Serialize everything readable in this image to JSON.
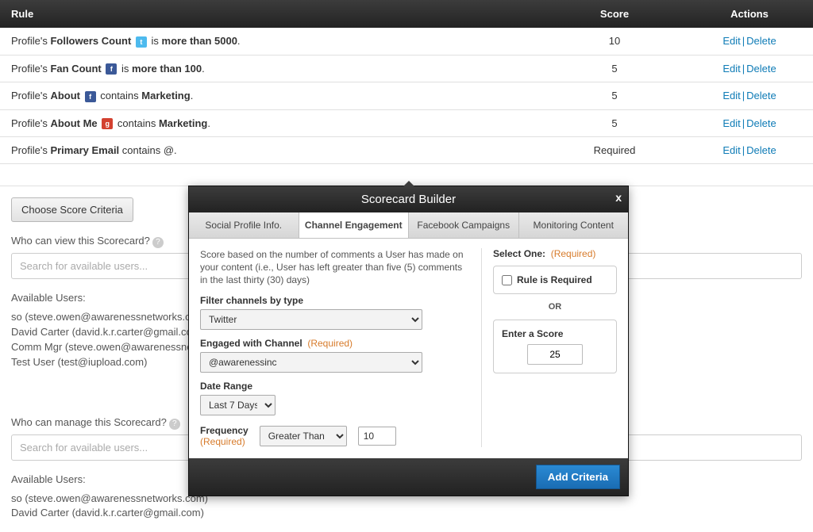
{
  "table": {
    "headers": {
      "rule": "Rule",
      "score": "Score",
      "actions": "Actions"
    },
    "actions": {
      "edit": "Edit",
      "delete": "Delete",
      "sep": "|"
    },
    "rows": [
      {
        "prefix": "Profile's ",
        "field": "Followers Count",
        "icon": "tw",
        "icon_glyph": "t",
        "after_icon": " is ",
        "value": "more than 5000",
        "suffix": ".",
        "score": "10"
      },
      {
        "prefix": "Profile's ",
        "field": "Fan Count",
        "icon": "fb",
        "icon_glyph": "f",
        "after_icon": " is ",
        "value": "more than 100",
        "suffix": ".",
        "score": "5"
      },
      {
        "prefix": "Profile's ",
        "field": "About",
        "icon": "fb",
        "icon_glyph": "f",
        "after_icon": " contains ",
        "value": "Marketing",
        "suffix": ".",
        "score": "5"
      },
      {
        "prefix": "Profile's ",
        "field": "About Me",
        "icon": "gp",
        "icon_glyph": "g",
        "after_icon": " contains ",
        "value": "Marketing",
        "suffix": ".",
        "score": "5"
      },
      {
        "prefix": "Profile's ",
        "field": "Primary Email",
        "icon": "",
        "icon_glyph": "",
        "after_icon": " contains @",
        "value": "",
        "suffix": ".",
        "score": "Required"
      }
    ]
  },
  "buttons": {
    "choose_criteria": "Choose Score Criteria"
  },
  "view": {
    "label": "Who can view this Scorecard?",
    "placeholder": "Search for available users...",
    "available_label": "Available Users:",
    "users": [
      "so (steve.owen@awarenessnetworks.com)",
      "David Carter (david.k.r.carter@gmail.com)",
      "Comm Mgr (steve.owen@awarenessnetwork",
      "Test User (test@iupload.com)"
    ]
  },
  "manage": {
    "label": "Who can manage this Scorecard?",
    "placeholder": "Search for available users...",
    "available_label": "Available Users:",
    "users": [
      "so (steve.owen@awarenessnetworks.com)",
      "David Carter (david.k.r.carter@gmail.com)"
    ]
  },
  "modal": {
    "title": "Scorecard Builder",
    "close": "x",
    "tabs": [
      "Social Profile Info.",
      "Channel Engagement",
      "Facebook Campaigns",
      "Monitoring Content"
    ],
    "active_tab": 1,
    "desc": "Score based on the number of comments a User has made on your content (i.e., User has left greater than five (5) comments in the last thirty (30) days)",
    "filter_label": "Filter channels by type",
    "filter_value": "Twitter",
    "engaged_label": "Engaged with Channel",
    "engaged_value": "@awarenessinc",
    "date_label": "Date Range",
    "date_value": "Last 7 Days",
    "freq_label": "Frequency",
    "freq_op": "Greater Than",
    "freq_val": "10",
    "required_marker": "(Required)",
    "select_one": "Select One:",
    "rule_required": "Rule is Required",
    "or": "OR",
    "enter_score": "Enter a Score",
    "score_value": "25",
    "add_criteria": "Add Criteria"
  }
}
